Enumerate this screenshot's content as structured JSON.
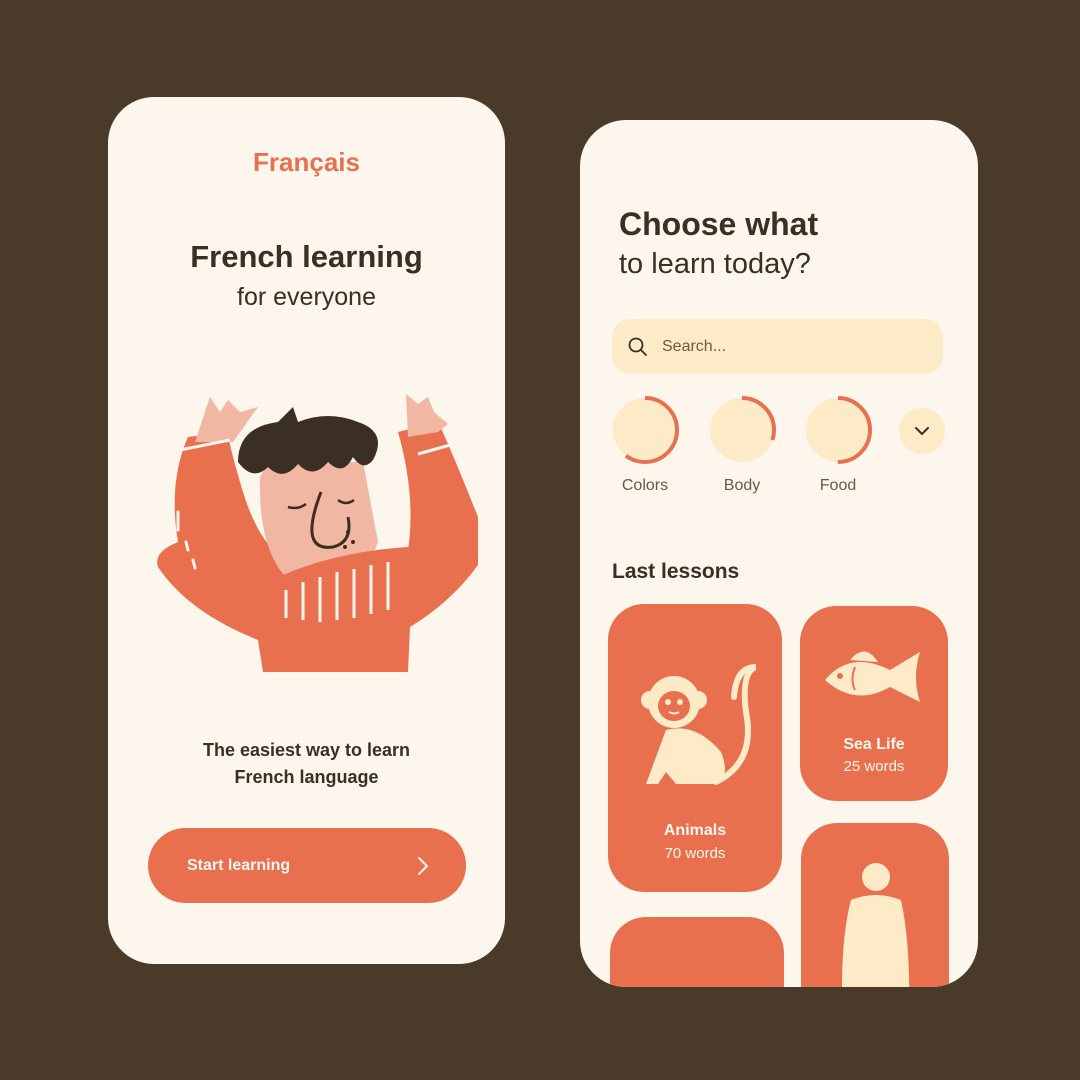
{
  "left_screen": {
    "brand": "Français",
    "title": "French learning",
    "subtitle": "for everyone",
    "tagline_line1": "The easiest way to learn",
    "tagline_line2": "French language",
    "start_button_label": "Start learning"
  },
  "right_screen": {
    "title_line1": "Choose what",
    "title_line2": "to learn today?",
    "search": {
      "placeholder": "Search..."
    },
    "categories": [
      {
        "label": "Colors",
        "progress": 0.6
      },
      {
        "label": "Body",
        "progress": 0.3
      },
      {
        "label": "Food",
        "progress": 0.5
      }
    ],
    "section_title": "Last lessons",
    "lessons": [
      {
        "name": "Animals",
        "count": "70 words",
        "icon": "monkey-icon"
      },
      {
        "name": "Sea Life",
        "count": "25 words",
        "icon": "fish-icon"
      },
      {
        "name": "",
        "count": "",
        "icon": "person-icon"
      }
    ]
  },
  "colors": {
    "background": "#4a3a2a",
    "screen": "#fdf6ec",
    "accent": "#e8704f",
    "soft": "#fdebc8",
    "text": "#3b2e22"
  }
}
